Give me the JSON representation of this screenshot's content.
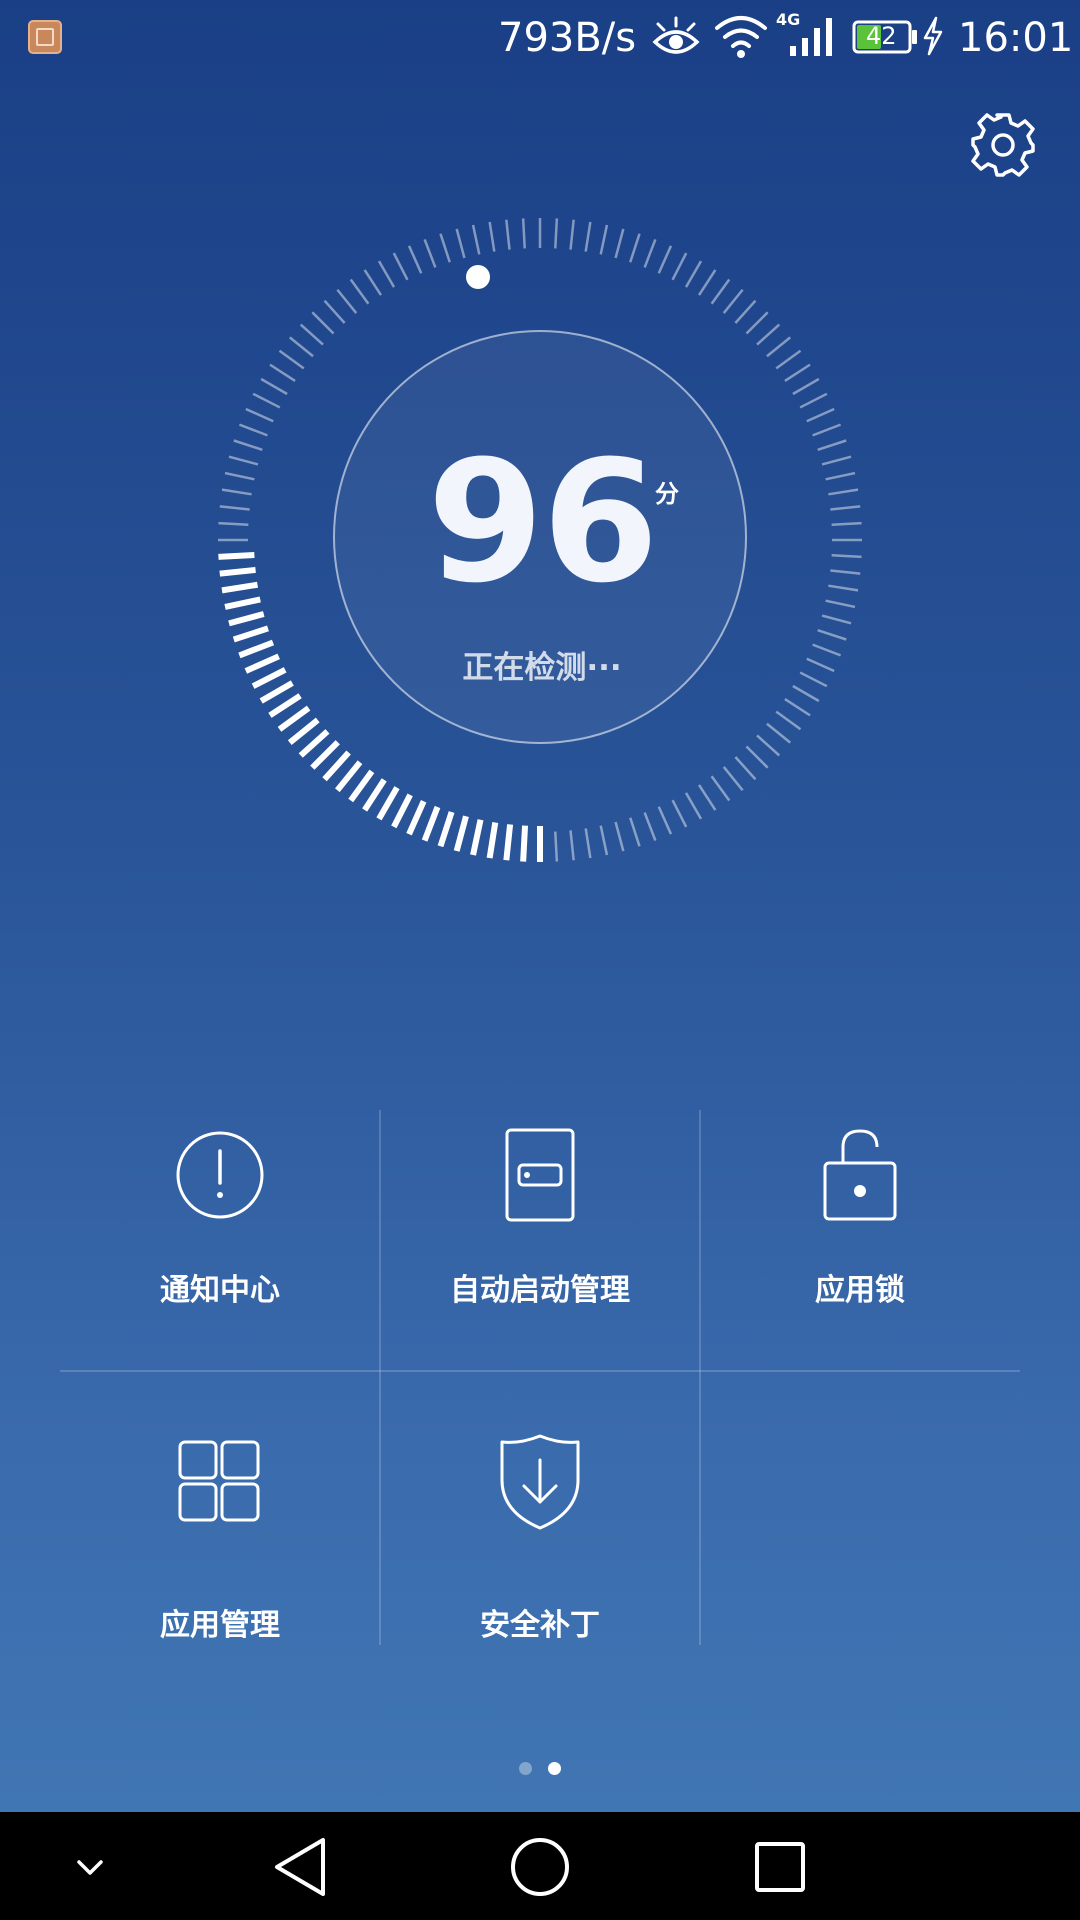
{
  "status_bar": {
    "network_speed": "793B/s",
    "network_type": "4G",
    "battery_level": "42",
    "time": "16:01",
    "icons": [
      "app-notification-icon",
      "eye-icon",
      "wifi-icon",
      "cellular-signal-icon",
      "battery-icon",
      "charging-icon"
    ]
  },
  "header": {
    "settings_icon": "gear-icon"
  },
  "score": {
    "value": "96",
    "unit": "分",
    "status": "正在检测···",
    "scan_progress": 0.25
  },
  "features": [
    {
      "label": "通知中心",
      "icon": "alert-circle-icon"
    },
    {
      "label": "自动启动管理",
      "icon": "phone-toggle-icon"
    },
    {
      "label": "应用锁",
      "icon": "unlock-icon"
    },
    {
      "label": "应用管理",
      "icon": "grid-apps-icon"
    },
    {
      "label": "安全补丁",
      "icon": "shield-download-icon"
    }
  ],
  "pagination": {
    "total": 2,
    "active": 1
  },
  "nav_bar": {
    "icons": [
      "chevron-down-icon",
      "back-triangle-icon",
      "home-circle-icon",
      "recents-square-icon"
    ]
  },
  "colors": {
    "bg_top": "#1a3f86",
    "bg_bottom": "#4279b5",
    "nav_bg": "#000000",
    "battery_fill": "#5ac33a"
  }
}
